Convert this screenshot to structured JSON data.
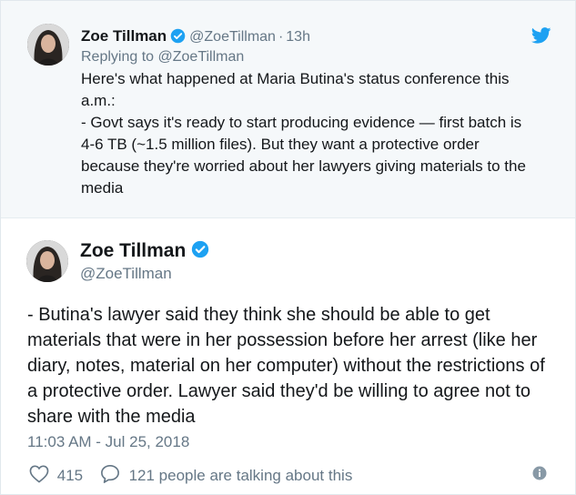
{
  "colors": {
    "brand": "#1da1f2",
    "text": "#14171a",
    "muted": "#657786",
    "parent_bg": "#f5f8fa"
  },
  "parent_tweet": {
    "name": "Zoe Tillman",
    "handle": "@ZoeTillman",
    "separator": "·",
    "time": "13h",
    "replying_prefix": "Replying to",
    "replying_handle": "@ZoeTillman",
    "text": "Here's what happened at Maria Butina's status conference this\na.m.:\n- Govt says it's ready to start producing evidence — first batch is\n4-6 TB (~1.5 million files). But they want a protective order\nbecause they're worried about her lawyers giving materials to the\nmedia",
    "icons": [
      "verified-badge-icon",
      "twitter-bird-icon"
    ]
  },
  "main_tweet": {
    "name": "Zoe Tillman",
    "handle": "@ZoeTillman",
    "text": "- Butina's lawyer said they think she should be able to get\nmaterials that were in her possession before her arrest (like her\ndiary, notes, material on her computer) without the restrictions of\na protective order. Lawyer said they'd be willing to agree not to\nshare with the media",
    "timestamp": "11:03 AM - Jul 25, 2018",
    "likes": "415",
    "replies_text": "121 people are talking about this",
    "icons": [
      "verified-badge-icon",
      "heart-icon",
      "reply-bubble-icon",
      "info-icon"
    ]
  }
}
